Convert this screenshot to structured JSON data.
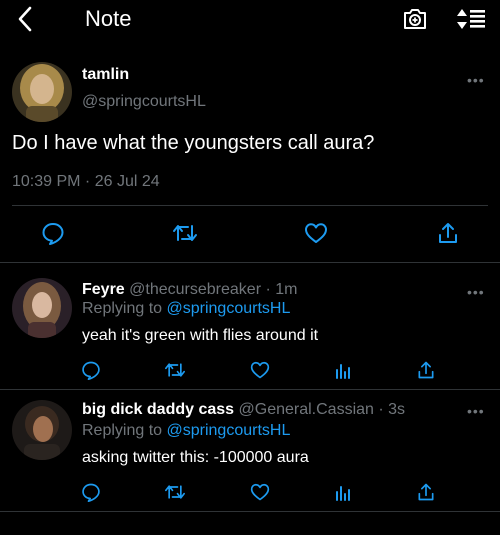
{
  "header": {
    "title": "Note"
  },
  "main_post": {
    "display_name": "tamlin",
    "handle": "@springcourtsHL",
    "text": "Do I have what the youngsters call aura?",
    "timestamp": "10:39 PM · 26 Jul 24"
  },
  "replies": [
    {
      "display_name": "Feyre",
      "handle": "@thecursebreaker",
      "time": " · 1m",
      "replying_prefix": "Replying to ",
      "replying_to": "@springcourtsHL",
      "text": "yeah it's green with flies around it"
    },
    {
      "display_name": "big dick daddy cass",
      "handle": "@General.Cassian",
      "time": " · 3s",
      "replying_prefix": "Replying to ",
      "replying_to": "@springcourtsHL",
      "text": "asking twitter this: -100000 aura"
    }
  ],
  "colors": {
    "accent": "#1d9bf0",
    "background": "#000000",
    "muted": "#71767b",
    "divider": "#2f3336"
  },
  "icons": [
    "back-icon",
    "add-photo-icon",
    "sort-icon",
    "more-icon",
    "reply-icon",
    "retweet-icon",
    "like-icon",
    "share-icon",
    "analytics-icon"
  ]
}
